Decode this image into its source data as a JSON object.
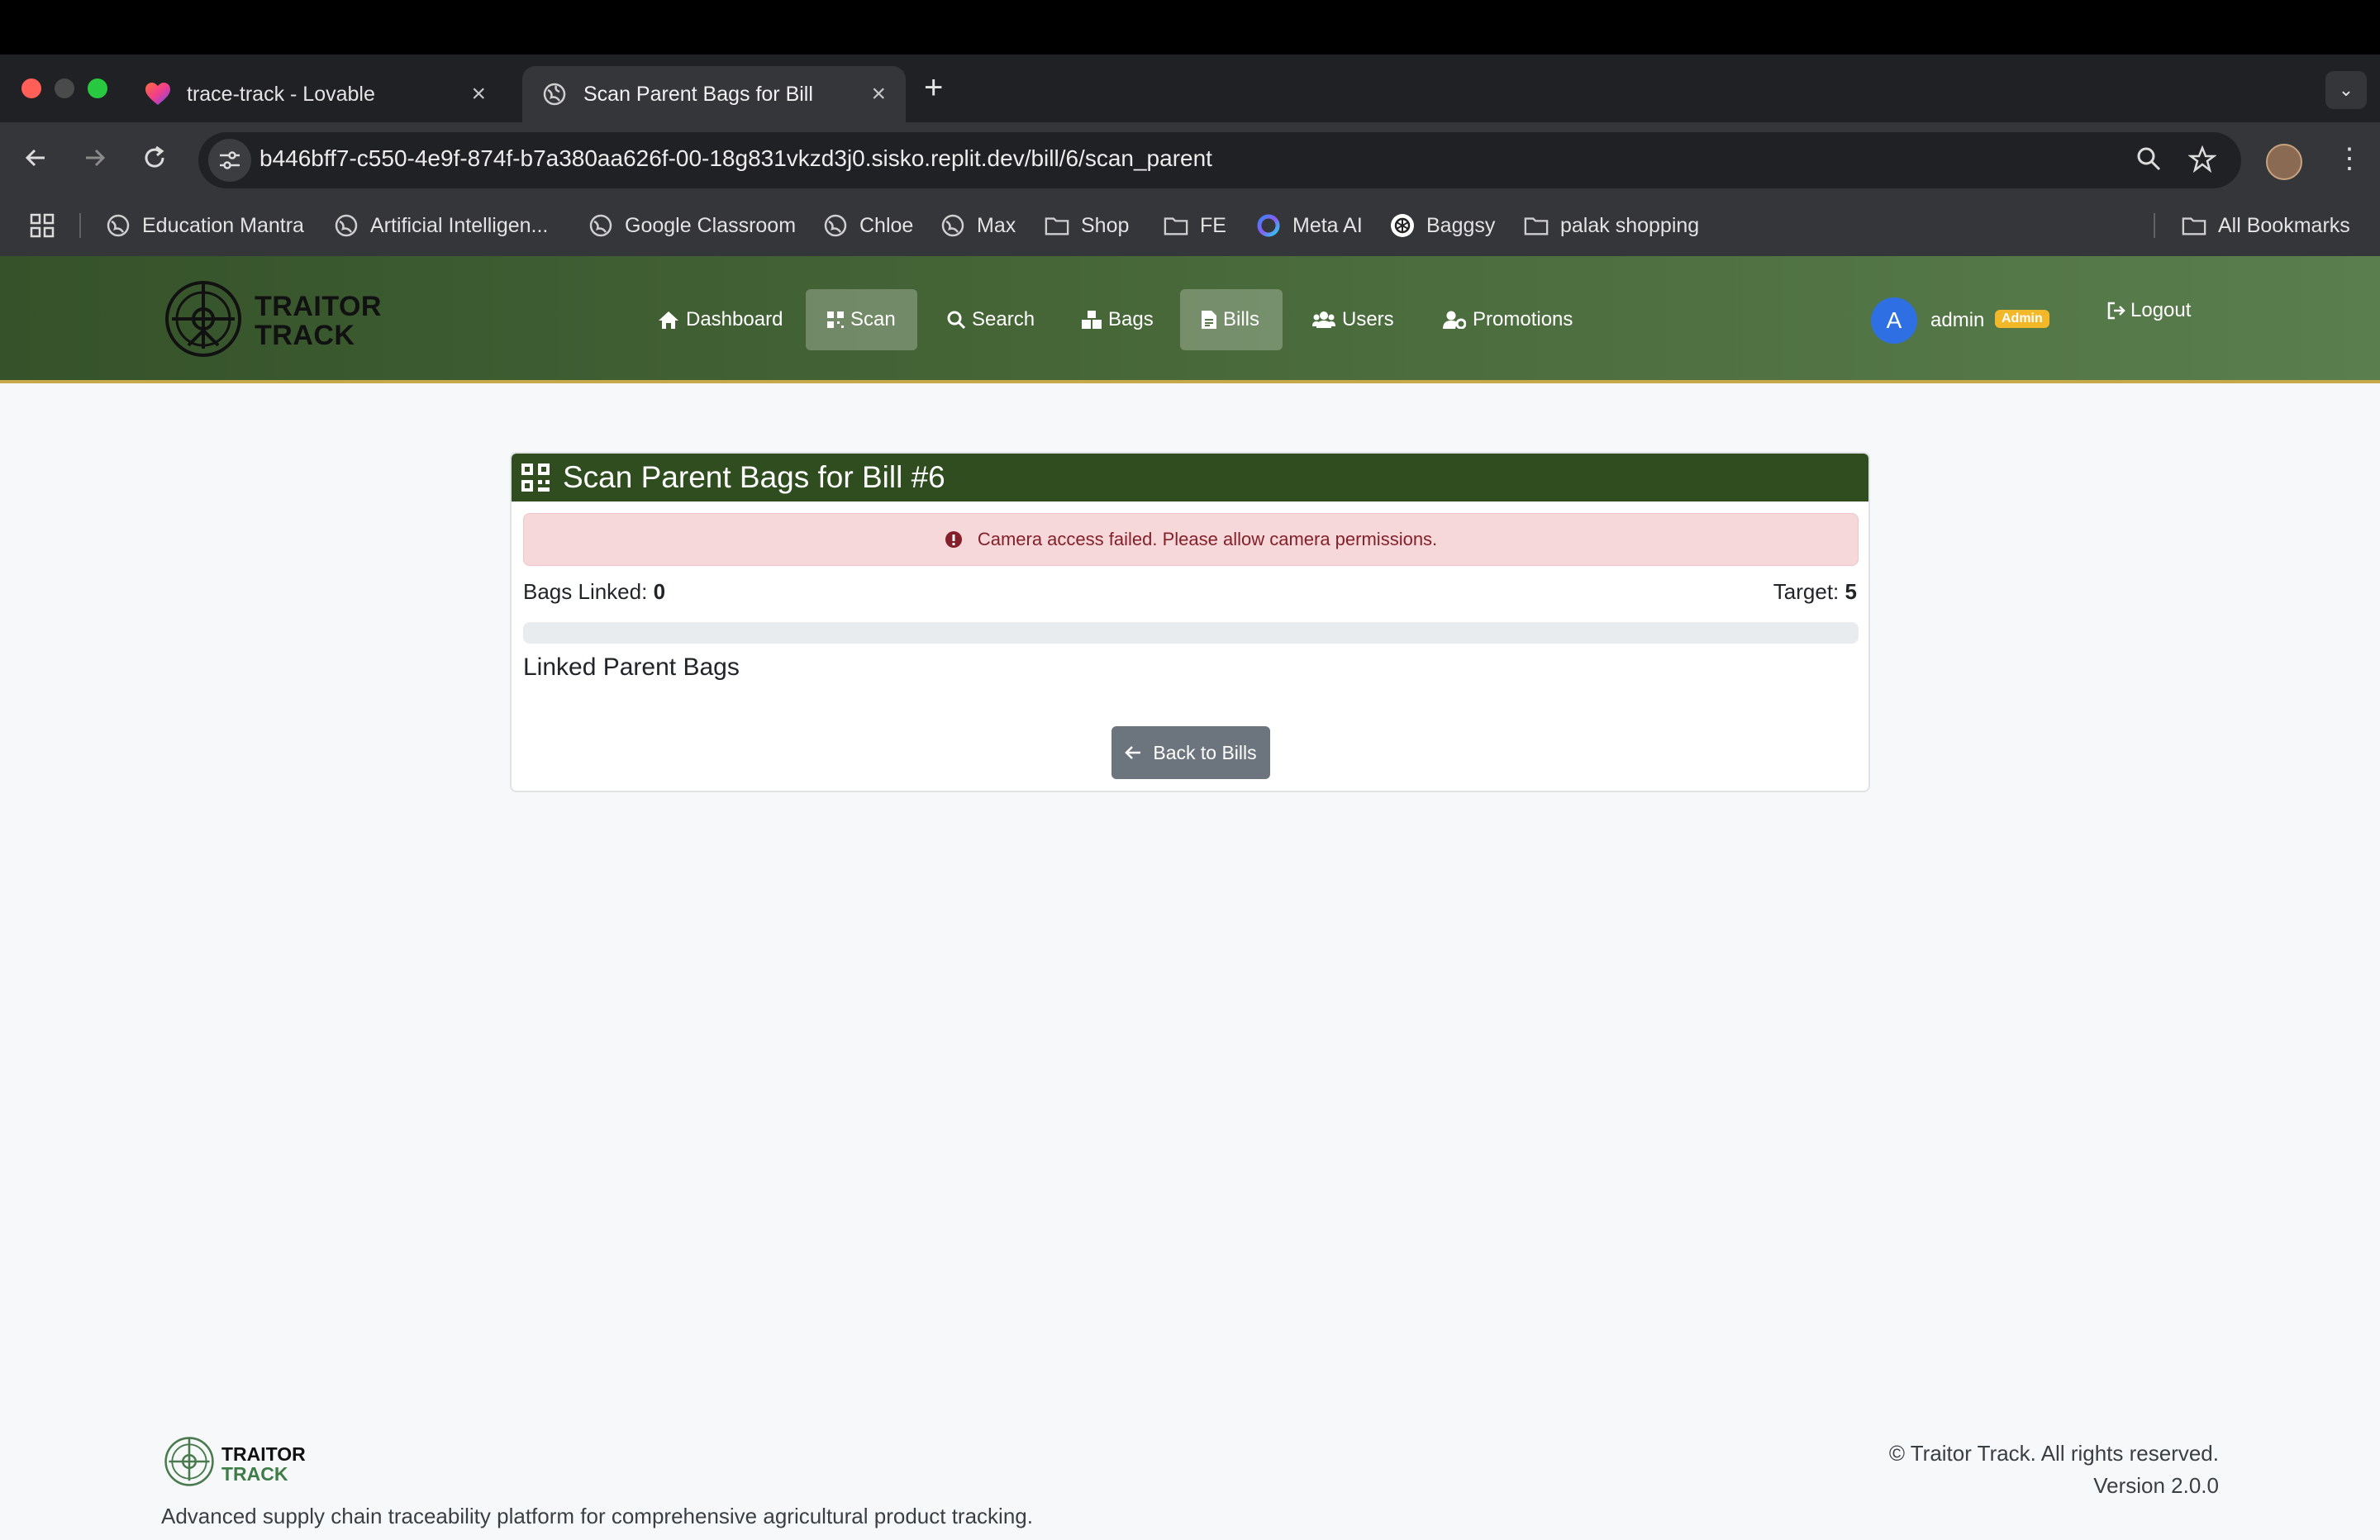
{
  "browser": {
    "tabs": [
      {
        "title": "trace-track - Lovable",
        "favicon": "lovable-heart-icon",
        "active": false
      },
      {
        "title": "Scan Parent Bags for Bill",
        "favicon": "globe-icon",
        "active": true
      }
    ],
    "url": "b446bff7-c550-4e9f-874f-b7a380aa626f-00-18g831vkzd3j0.sisko.replit.dev/bill/6/scan_parent",
    "bookmarks": [
      {
        "label": "Education Mantra",
        "icon": "globe-icon"
      },
      {
        "label": "Artificial Intelligen...",
        "icon": "globe-icon"
      },
      {
        "label": "Google Classroom",
        "icon": "globe-icon"
      },
      {
        "label": "Chloe",
        "icon": "globe-icon"
      },
      {
        "label": "Max",
        "icon": "globe-icon"
      },
      {
        "label": "Shop",
        "icon": "folder-icon"
      },
      {
        "label": "FE",
        "icon": "folder-icon"
      },
      {
        "label": "Meta AI",
        "icon": "meta-ai-icon"
      },
      {
        "label": "Baggsy",
        "icon": "openai-icon"
      },
      {
        "label": "palak shopping",
        "icon": "folder-icon"
      }
    ],
    "all_bookmarks": "All Bookmarks"
  },
  "app": {
    "brand_line1": "TRAITOR",
    "brand_line2": "TRACK",
    "nav": [
      {
        "label": "Dashboard",
        "icon": "home-icon",
        "active": false
      },
      {
        "label": "Scan",
        "icon": "qrcode-icon",
        "active": true
      },
      {
        "label": "Search",
        "icon": "search-icon",
        "active": false
      },
      {
        "label": "Bags",
        "icon": "boxes-icon",
        "active": false
      },
      {
        "label": "Bills",
        "icon": "file-icon",
        "active": true
      },
      {
        "label": "Users",
        "icon": "users-icon",
        "active": false
      },
      {
        "label": "Promotions",
        "icon": "user-cog-icon",
        "active": false
      }
    ],
    "user": {
      "initial": "A",
      "name": "admin",
      "role": "Admin"
    },
    "logout": "Logout"
  },
  "card": {
    "title": "Scan Parent Bags for Bill #6",
    "alert": "Camera access failed. Please allow camera permissions.",
    "linked_label": "Bags Linked:",
    "linked_value": "0",
    "target_label": "Target:",
    "target_value": "5",
    "progress": 0,
    "list_title": "Linked Parent Bags",
    "back_button": "Back to Bills"
  },
  "footer": {
    "brand_line1": "TRAITOR",
    "brand_line2": "TRACK",
    "description": "Advanced supply chain traceability platform for comprehensive agricultural product tracking.",
    "copyright": "© Traitor Track. All rights reserved.",
    "version": "Version 2.0.0"
  },
  "colors": {
    "nav_green": "#35522a",
    "header_green": "#2f4d1f",
    "alert_bg": "#f6d8da",
    "alert_text": "#842029",
    "admin_badge": "#f2b829",
    "avatar_blue": "#2f6fe4"
  }
}
